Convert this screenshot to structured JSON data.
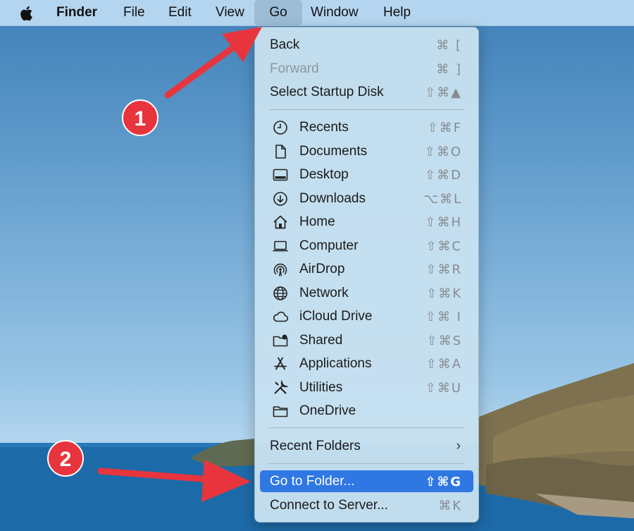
{
  "menubar": {
    "apple_icon": "apple-logo-icon",
    "items": [
      "Finder",
      "File",
      "Edit",
      "View",
      "Go",
      "Window",
      "Help"
    ]
  },
  "go_menu": {
    "top_items": [
      {
        "label": "Back",
        "shortcut": "⌘ [",
        "enabled": true
      },
      {
        "label": "Forward",
        "shortcut": "⌘ ]",
        "enabled": false
      },
      {
        "label": "Select Startup Disk",
        "shortcut": "⇧⌘▲",
        "enabled": true
      }
    ],
    "places": [
      {
        "label": "Recents",
        "icon": "clock-icon",
        "shortcut": "⇧⌘F"
      },
      {
        "label": "Documents",
        "icon": "document-icon",
        "shortcut": "⇧⌘O"
      },
      {
        "label": "Desktop",
        "icon": "desktop-icon",
        "shortcut": "⇧⌘D"
      },
      {
        "label": "Downloads",
        "icon": "download-icon",
        "shortcut": "⌥⌘L"
      },
      {
        "label": "Home",
        "icon": "home-icon",
        "shortcut": "⇧⌘H"
      },
      {
        "label": "Computer",
        "icon": "laptop-icon",
        "shortcut": "⇧⌘C"
      },
      {
        "label": "AirDrop",
        "icon": "airdrop-icon",
        "shortcut": "⇧⌘R"
      },
      {
        "label": "Network",
        "icon": "globe-icon",
        "shortcut": "⇧⌘K"
      },
      {
        "label": "iCloud Drive",
        "icon": "cloud-icon",
        "shortcut": "⇧⌘ I"
      },
      {
        "label": "Shared",
        "icon": "shared-folder-icon",
        "shortcut": "⇧⌘S"
      },
      {
        "label": "Applications",
        "icon": "applications-icon",
        "shortcut": "⇧⌘A"
      },
      {
        "label": "Utilities",
        "icon": "utilities-icon",
        "shortcut": "⇧⌘U"
      },
      {
        "label": "OneDrive",
        "icon": "folder-icon",
        "shortcut": ""
      }
    ],
    "recent_folders": {
      "label": "Recent Folders",
      "icon": "chevron-right-icon"
    },
    "go_to_folder": {
      "label": "Go to Folder...",
      "shortcut": "⇧⌘G",
      "highlighted": true
    },
    "connect_to_server": {
      "label": "Connect to Server...",
      "shortcut": "⌘K"
    }
  },
  "annotations": {
    "step1": "1",
    "step2": "2",
    "color": "#e8353d"
  },
  "colors": {
    "highlight": "#2f77e3",
    "menubar": "#bedcf4",
    "menu_bg": "#c6e0f0"
  }
}
